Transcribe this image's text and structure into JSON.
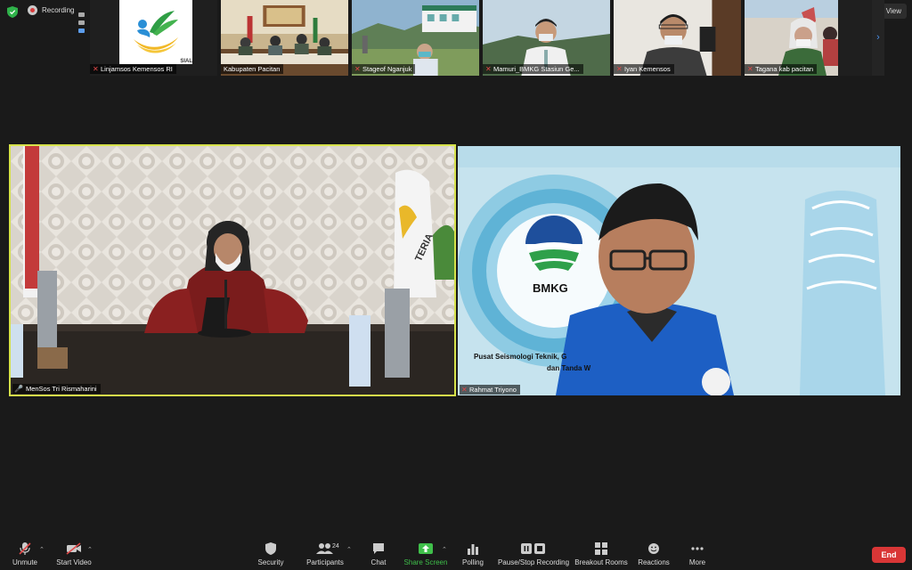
{
  "topbar": {
    "recording_label": "Recording",
    "view_label": "View"
  },
  "gallery": [
    {
      "name": "Linjamsos Kemensos RI",
      "muted": true,
      "logo_text": "SIAL"
    },
    {
      "name": "Kabupaten Pacitan",
      "muted": false
    },
    {
      "name": "Stageof Nganjuk",
      "muted": true
    },
    {
      "name": "Mamuri_BMKG Stasiun Ge...",
      "muted": true
    },
    {
      "name": "Iyan Kemensos",
      "muted": true
    },
    {
      "name": "Tagana kab pacitan",
      "muted": true
    }
  ],
  "main": {
    "left": {
      "name": "MenSos Tri Rismaharini",
      "flag_text": "TERIA"
    },
    "right": {
      "name": "Rahmat Triyono",
      "logo_text": "BMKG",
      "caption_line1": "Pusat Seismologi Teknik, G",
      "caption_line2": "dan Tanda W"
    }
  },
  "toolbar": {
    "unmute": "Unmute",
    "start_video": "Start Video",
    "security": "Security",
    "participants": "Participants",
    "participants_count": "24",
    "chat": "Chat",
    "share_screen": "Share Screen",
    "polling": "Polling",
    "pause_recording": "Pause/Stop Recording",
    "breakout_rooms": "Breakout Rooms",
    "reactions": "Reactions",
    "more": "More",
    "end": "End"
  },
  "colors": {
    "active_speaker_border": "#d6e24a",
    "end_button": "#d93636",
    "share_green": "#3fbf4a",
    "muted_red": "#e04848"
  }
}
